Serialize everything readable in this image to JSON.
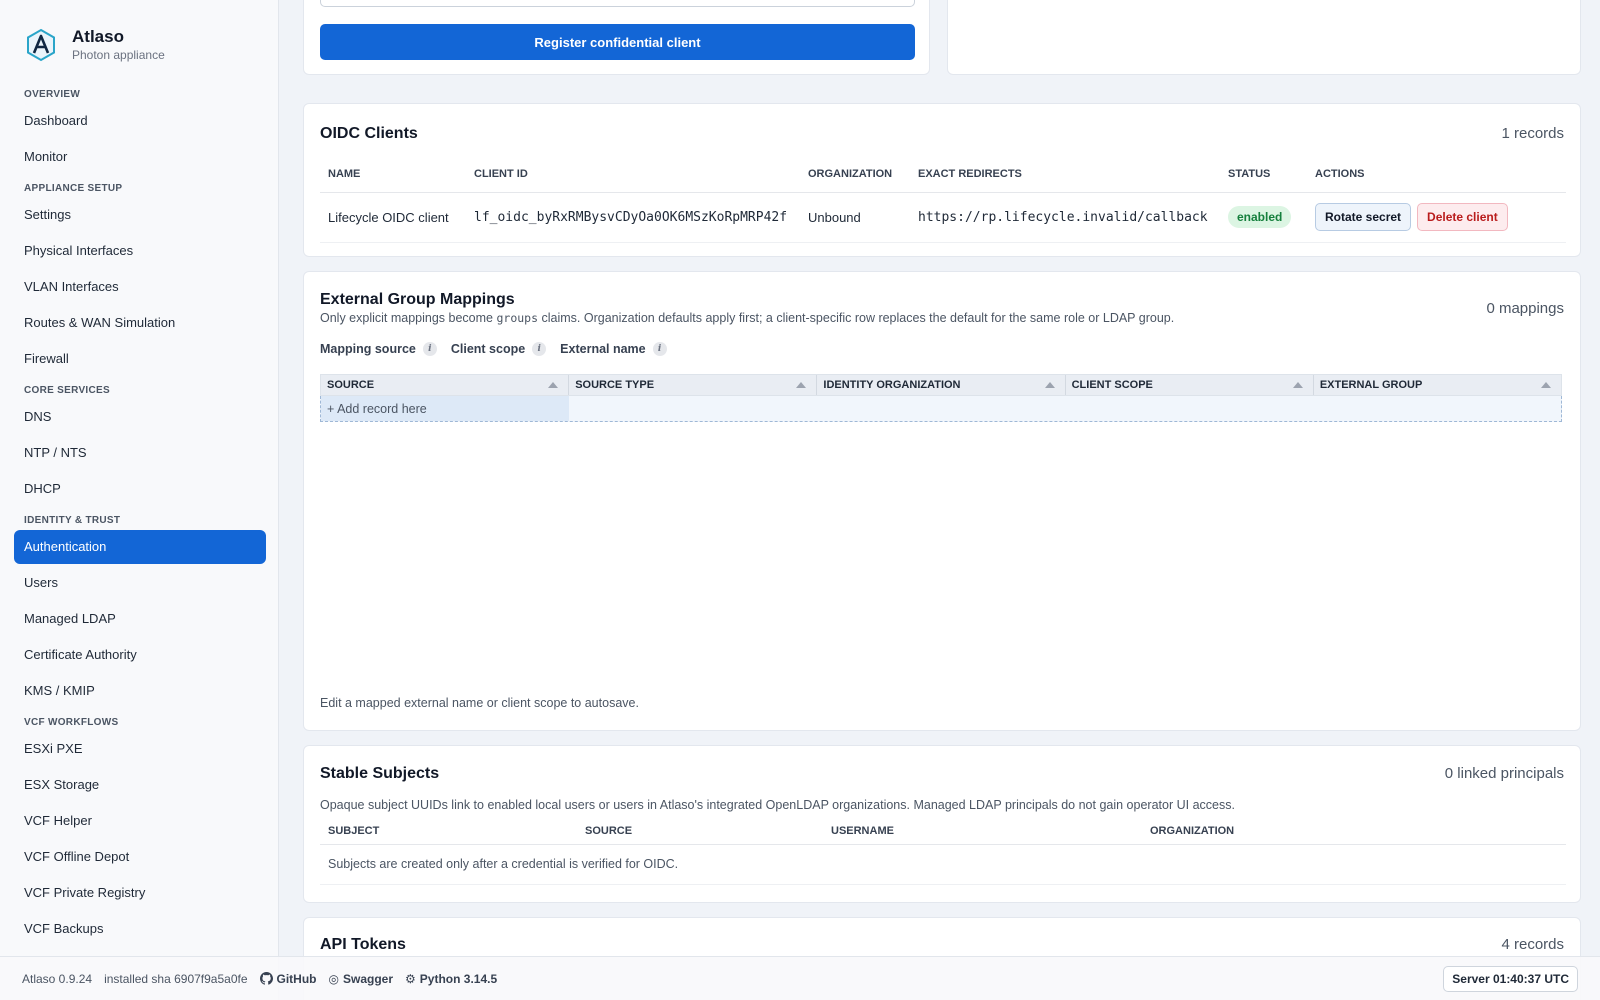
{
  "brand": {
    "name": "Atlaso",
    "subtitle": "Photon appliance"
  },
  "sidebar": {
    "groups": [
      {
        "label": "OVERVIEW",
        "items": [
          "Dashboard",
          "Monitor"
        ]
      },
      {
        "label": "APPLIANCE SETUP",
        "items": [
          "Settings",
          "Physical Interfaces",
          "VLAN Interfaces",
          "Routes & WAN Simulation",
          "Firewall"
        ]
      },
      {
        "label": "CORE SERVICES",
        "items": [
          "DNS",
          "NTP / NTS",
          "DHCP"
        ]
      },
      {
        "label": "IDENTITY & TRUST",
        "items": [
          "Authentication",
          "Users",
          "Managed LDAP",
          "Certificate Authority",
          "KMS / KMIP"
        ]
      },
      {
        "label": "VCF WORKFLOWS",
        "items": [
          "ESXi PXE",
          "ESX Storage",
          "VCF Helper",
          "VCF Offline Depot",
          "VCF Private Registry",
          "VCF Backups"
        ]
      }
    ],
    "active_item": "Authentication"
  },
  "register": {
    "button_label": "Register confidential client"
  },
  "oidc": {
    "title": "OIDC Clients",
    "count": "1 records",
    "columns": [
      "NAME",
      "CLIENT ID",
      "ORGANIZATION",
      "EXACT REDIRECTS",
      "STATUS",
      "ACTIONS"
    ],
    "rows": [
      {
        "name": "Lifecycle OIDC client",
        "client_id": "lf_oidc_byRxRMBysvCDyOa0OK6MSzKoRpMRP42f",
        "organization": "Unbound",
        "redirects": "https://rp.lifecycle.invalid/callback",
        "status": "enabled",
        "rotate_label": "Rotate secret",
        "delete_label": "Delete client"
      }
    ]
  },
  "egm": {
    "title": "External Group Mappings",
    "count": "0 mappings",
    "desc_before": "Only explicit mappings become ",
    "desc_code": "groups",
    "desc_after": " claims. Organization defaults apply first; a client-specific row replaces the default for the same role or LDAP group.",
    "filters": [
      "Mapping source",
      "Client scope",
      "External name"
    ],
    "columns": [
      "SOURCE",
      "SOURCE TYPE",
      "IDENTITY ORGANIZATION",
      "CLIENT SCOPE",
      "EXTERNAL GROUP"
    ],
    "add_record": "+ Add record here",
    "footer": "Edit a mapped external name or client scope to autosave."
  },
  "stable": {
    "title": "Stable Subjects",
    "count": "0 linked principals",
    "desc": "Opaque subject UUIDs link to enabled local users or users in Atlaso's integrated OpenLDAP organizations. Managed LDAP principals do not gain operator UI access.",
    "columns": [
      "SUBJECT",
      "SOURCE",
      "USERNAME",
      "ORGANIZATION"
    ],
    "empty": "Subjects are created only after a credential is verified for OIDC."
  },
  "api": {
    "title": "API Tokens",
    "count": "4 records"
  },
  "footer": {
    "version": "Atlaso 0.9.24",
    "sha": "installed sha 6907f9a5a0fe",
    "github": "GitHub",
    "swagger": "Swagger",
    "python": "Python 3.14.5",
    "server_time": "Server 01:40:37 UTC"
  },
  "colors": {
    "accent": "#1366d6",
    "success": "#15803d",
    "danger": "#b91c1c"
  }
}
